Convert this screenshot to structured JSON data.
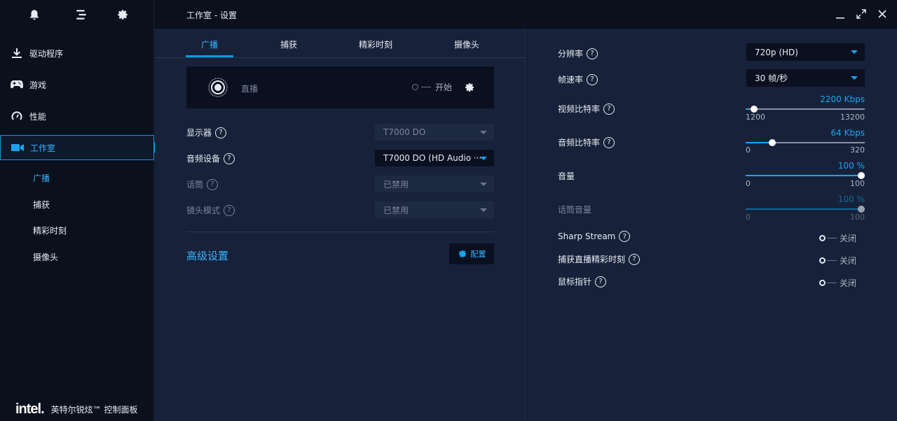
{
  "window": {
    "title": "工作室 - 设置"
  },
  "sidebar": {
    "items": [
      {
        "label": "驱动程序",
        "icon": "download-icon"
      },
      {
        "label": "游戏",
        "icon": "gamepad-icon"
      },
      {
        "label": "性能",
        "icon": "gauge-icon"
      },
      {
        "label": "工作室",
        "icon": "camera-icon",
        "active": true
      }
    ],
    "sub_items": [
      {
        "label": "广播",
        "active": true
      },
      {
        "label": "捕获"
      },
      {
        "label": "精彩时刻"
      },
      {
        "label": "摄像头"
      }
    ],
    "footer": {
      "logo": "intel.",
      "product": "英特尔锐炫™ 控制面板"
    }
  },
  "tabs": [
    "广播",
    "捕获",
    "精彩时刻",
    "摄像头"
  ],
  "broadcast": {
    "live_label": "直播",
    "start_label": "开始",
    "fields": [
      {
        "label": "显示器",
        "value": "T7000 DO",
        "enabled": false,
        "label_disabled": false
      },
      {
        "label": "音频设备",
        "value": "T7000 DO (HD Audio ···",
        "enabled": true,
        "label_disabled": false
      },
      {
        "label": "话筒",
        "value": "已禁用",
        "enabled": false,
        "label_disabled": true
      },
      {
        "label": "镜头模式",
        "value": "已禁用",
        "enabled": false,
        "label_disabled": true
      }
    ],
    "advanced_title": "高级设置",
    "config_label": "配置"
  },
  "settings": {
    "resolution": {
      "label": "分辨率",
      "value": "720p (HD)"
    },
    "framerate": {
      "label": "帧速率",
      "value": "30 帧/秒"
    },
    "video_bitrate": {
      "label": "视频比特率",
      "value_text": "2200 Kbps",
      "min": "1200",
      "max": "13200",
      "value": 1200
    },
    "audio_bitrate": {
      "label": "音频比特率",
      "value_text": "64 Kbps",
      "min": "0",
      "max": "320",
      "value": 64
    },
    "volume": {
      "label": "音量",
      "value_text": "100 %",
      "min": "0",
      "max": "100",
      "value": 100
    },
    "mic_volume": {
      "label": "话筒音量",
      "value_text": "100 %",
      "min": "0",
      "max": "100",
      "value": 100
    },
    "sharp_stream": {
      "label": "Sharp Stream",
      "state": "关闭"
    },
    "capture_highlights": {
      "label": "捕获直播精彩时刻",
      "state": "关闭"
    },
    "mouse_pointer": {
      "label": "鼠标指针",
      "state": "关闭"
    }
  },
  "colors": {
    "accent": "#1aa4f0",
    "panel": "#17223a",
    "sidebar": "#0a101c"
  }
}
